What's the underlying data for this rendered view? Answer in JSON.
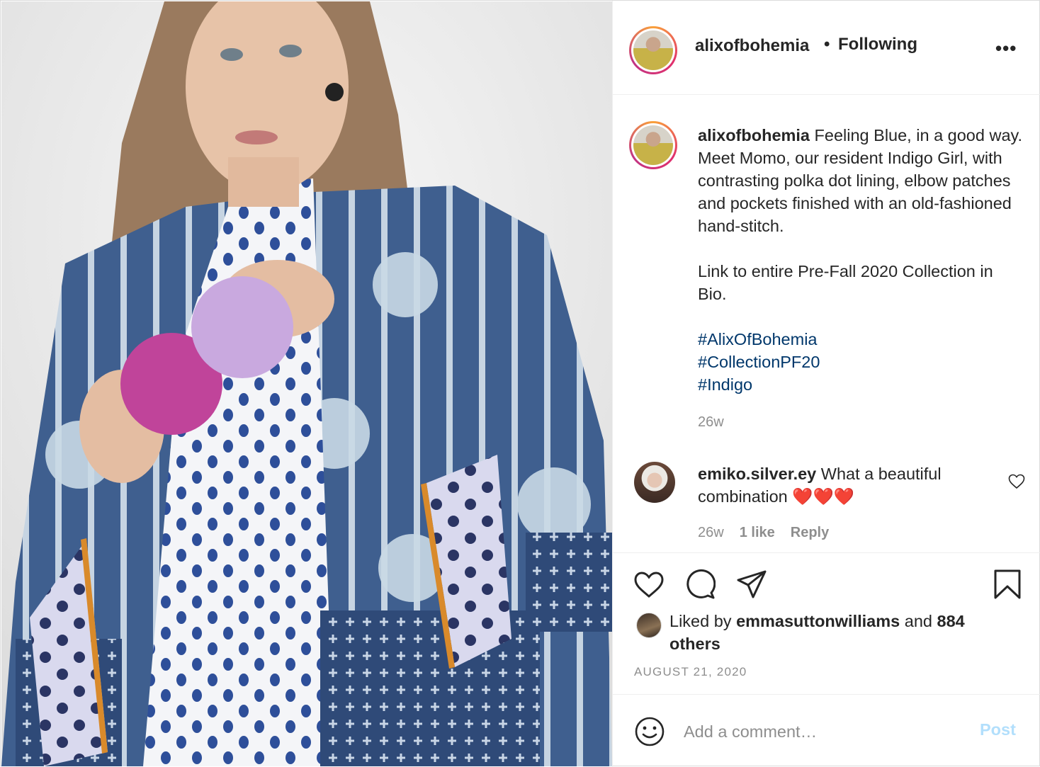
{
  "header": {
    "username": "alixofbohemia",
    "separator": "•",
    "follow_status": "Following",
    "more_label": "•••"
  },
  "caption": {
    "username": "alixofbohemia",
    "text_line1": "Feeling Blue, in a good way. Meet Momo, our resident Indigo Girl, with contrasting polka dot lining, elbow patches and pockets finished with an old-fashioned hand-stitch.",
    "text_line2": "Link to entire Pre-Fall 2020 Collection in Bio.",
    "hashtags": [
      "#AlixOfBohemia",
      "#CollectionPF20",
      "#Indigo"
    ],
    "time": "26w"
  },
  "comment": {
    "username": "emiko.silver.ey",
    "text": "What a beautiful combination ❤️❤️❤️",
    "time": "26w",
    "likes": "1 like",
    "reply_label": "Reply"
  },
  "likes": {
    "prefix": "Liked by",
    "user": "emmasuttonwilliams",
    "joiner": "and",
    "others": "884 others"
  },
  "post_date": "AUGUST 21, 2020",
  "add_comment": {
    "placeholder": "Add a comment…",
    "post_label": "Post"
  },
  "icons": [
    "more-icon",
    "heart-icon",
    "comment-icon",
    "share-icon",
    "bookmark-icon",
    "emoji-icon"
  ],
  "colors": {
    "hashtag": "#00376b",
    "muted": "#8e8e8e",
    "post_button": "#b2dffc",
    "heart_emoji": "#ed4956"
  }
}
